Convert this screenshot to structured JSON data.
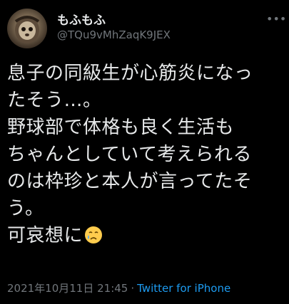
{
  "author": {
    "display_name": "もふもふ",
    "username": "@TQu9vMhZaqK9JEX",
    "avatar_icon": "avatar-photo"
  },
  "menu_icon": "more-icon",
  "tweet": {
    "lines": [
      "息子の同級生が心筋炎になっ",
      "たそう…。",
      "野球部で体格も良く生活も",
      "ちゃんとしていて考えられる",
      "のは枠珍と本人が言ってたそ",
      "う。",
      "可哀想に"
    ],
    "emoji": "crying-face-emoji"
  },
  "meta": {
    "timestamp": "2021年10月11日 21:45",
    "separator": "·",
    "source": "Twitter for iPhone"
  },
  "colors": {
    "background": "#000000",
    "text": "#e7e9ea",
    "secondary": "#71767b",
    "link": "#1d9bf0"
  }
}
